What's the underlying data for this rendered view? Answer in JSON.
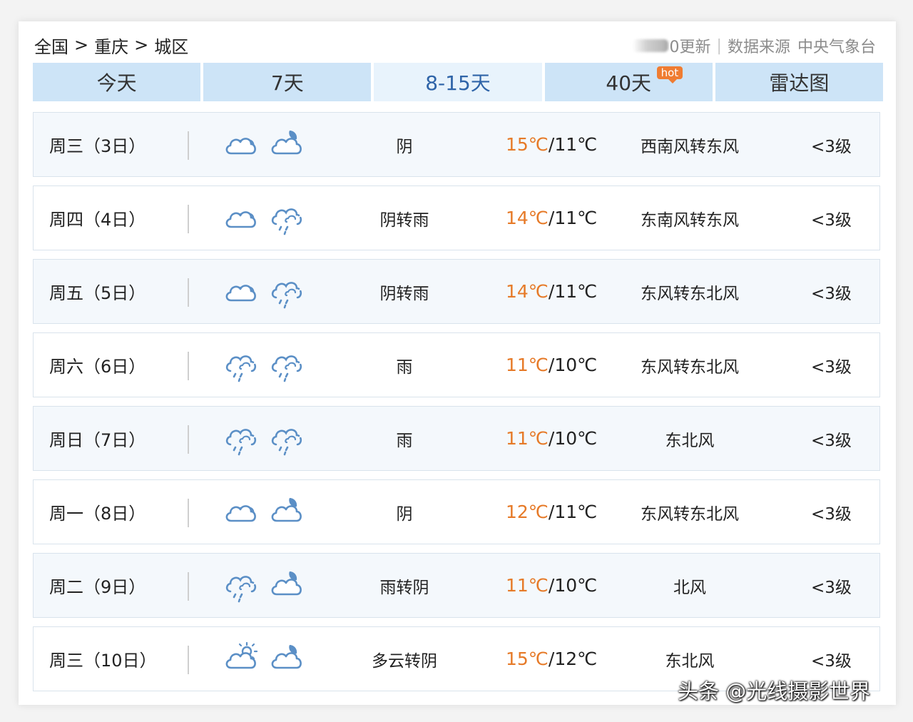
{
  "breadcrumb": [
    "全国",
    "重庆",
    "城区"
  ],
  "breadcrumb_sep": ">",
  "header": {
    "update_text": "0更新",
    "source_label": "数据来源",
    "source_name": "中央气象台"
  },
  "tabs": [
    {
      "label": "今天"
    },
    {
      "label": "7天"
    },
    {
      "label": "8-15天"
    },
    {
      "label": "40天"
    },
    {
      "label": "雷达图"
    }
  ],
  "hot_badge": "hot",
  "colors": {
    "tab_bg": "#cde4f7",
    "tab_active_bg": "#e8f3fc",
    "tab_active_text": "#2f64a8",
    "high_temp": "#e67a28",
    "icon": "#5b8fc6"
  },
  "forecast": [
    {
      "day": "周三（3日）",
      "icon_day": "cloud-icon",
      "icon_night": "moon-cloud-icon",
      "weather": "阴",
      "high": "15℃",
      "low": "/11℃",
      "wind": "西南风转东风",
      "level": "<3级"
    },
    {
      "day": "周四（4日）",
      "icon_day": "cloud-icon",
      "icon_night": "rain-icon",
      "weather": "阴转雨",
      "high": "14℃",
      "low": "/11℃",
      "wind": "东南风转东风",
      "level": "<3级"
    },
    {
      "day": "周五（5日）",
      "icon_day": "cloud-icon",
      "icon_night": "rain-icon",
      "weather": "阴转雨",
      "high": "14℃",
      "low": "/11℃",
      "wind": "东风转东北风",
      "level": "<3级"
    },
    {
      "day": "周六（6日）",
      "icon_day": "rain-icon",
      "icon_night": "rain-icon",
      "weather": "雨",
      "high": "11℃",
      "low": "/10℃",
      "wind": "东风转东北风",
      "level": "<3级"
    },
    {
      "day": "周日（7日）",
      "icon_day": "rain-icon",
      "icon_night": "rain-icon",
      "weather": "雨",
      "high": "11℃",
      "low": "/10℃",
      "wind": "东北风",
      "level": "<3级"
    },
    {
      "day": "周一（8日）",
      "icon_day": "cloud-icon",
      "icon_night": "moon-cloud-icon",
      "weather": "阴",
      "high": "12℃",
      "low": "/11℃",
      "wind": "东风转东北风",
      "level": "<3级"
    },
    {
      "day": "周二（9日）",
      "icon_day": "rain-icon",
      "icon_night": "moon-cloud-icon",
      "weather": "雨转阴",
      "high": "11℃",
      "low": "/10℃",
      "wind": "北风",
      "level": "<3级"
    },
    {
      "day": "周三（10日）",
      "icon_day": "sun-cloud-icon",
      "icon_night": "moon-cloud-icon",
      "weather": "多云转阴",
      "high": "15℃",
      "low": "/12℃",
      "wind": "东北风",
      "level": "<3级"
    }
  ],
  "watermark": "头条 @光线摄影世界"
}
